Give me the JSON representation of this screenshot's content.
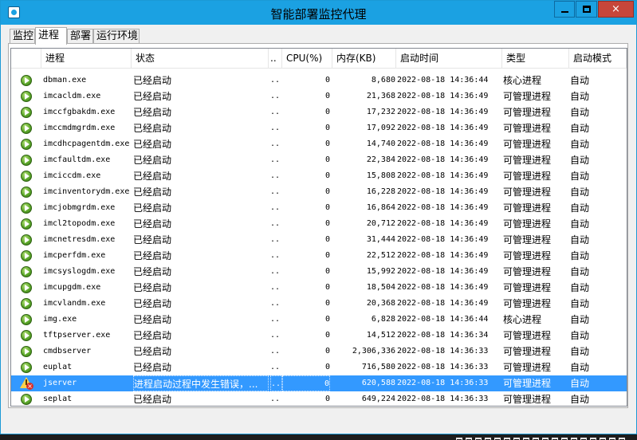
{
  "window": {
    "title": "智能部署监控代理",
    "min_label": "",
    "max_label": "",
    "close_label": "×"
  },
  "tabs": [
    {
      "label": "监控"
    },
    {
      "label": "进程"
    },
    {
      "label": "部署"
    },
    {
      "label": "运行环境"
    }
  ],
  "columns": {
    "process": "进程",
    "status": "状态",
    "more": "..",
    "cpu": "CPU(%)",
    "mem": "内存(KB)",
    "start_time": "启动时间",
    "type": "类型",
    "start_mode": "启动模式"
  },
  "rows": [
    {
      "icon": "ok",
      "name": "dbman.exe",
      "status": "已经启动",
      "more": "..",
      "cpu": "0",
      "mem": "8,680",
      "time": "2022-08-18 14:36:44",
      "type": "核心进程",
      "mode": "自动"
    },
    {
      "icon": "ok",
      "name": "imcacldm.exe",
      "status": "已经启动",
      "more": "..",
      "cpu": "0",
      "mem": "21,368",
      "time": "2022-08-18 14:36:49",
      "type": "可管理进程",
      "mode": "自动"
    },
    {
      "icon": "ok",
      "name": "imccfgbakdm.exe",
      "status": "已经启动",
      "more": "..",
      "cpu": "0",
      "mem": "17,232",
      "time": "2022-08-18 14:36:49",
      "type": "可管理进程",
      "mode": "自动"
    },
    {
      "icon": "ok",
      "name": "imccmdmgrdm.exe",
      "status": "已经启动",
      "more": "..",
      "cpu": "0",
      "mem": "17,092",
      "time": "2022-08-18 14:36:49",
      "type": "可管理进程",
      "mode": "自动"
    },
    {
      "icon": "ok",
      "name": "imcdhcpagentdm.exe",
      "status": "已经启动",
      "more": "..",
      "cpu": "0",
      "mem": "14,740",
      "time": "2022-08-18 14:36:49",
      "type": "可管理进程",
      "mode": "自动"
    },
    {
      "icon": "ok",
      "name": "imcfaultdm.exe",
      "status": "已经启动",
      "more": "..",
      "cpu": "0",
      "mem": "22,384",
      "time": "2022-08-18 14:36:49",
      "type": "可管理进程",
      "mode": "自动"
    },
    {
      "icon": "ok",
      "name": "imciccdm.exe",
      "status": "已经启动",
      "more": "..",
      "cpu": "0",
      "mem": "15,808",
      "time": "2022-08-18 14:36:49",
      "type": "可管理进程",
      "mode": "自动"
    },
    {
      "icon": "ok",
      "name": "imcinventorydm.exe",
      "status": "已经启动",
      "more": "..",
      "cpu": "0",
      "mem": "16,228",
      "time": "2022-08-18 14:36:49",
      "type": "可管理进程",
      "mode": "自动"
    },
    {
      "icon": "ok",
      "name": "imcjobmgrdm.exe",
      "status": "已经启动",
      "more": "..",
      "cpu": "0",
      "mem": "16,864",
      "time": "2022-08-18 14:36:49",
      "type": "可管理进程",
      "mode": "自动"
    },
    {
      "icon": "ok",
      "name": "imcl2topodm.exe",
      "status": "已经启动",
      "more": "..",
      "cpu": "0",
      "mem": "20,712",
      "time": "2022-08-18 14:36:49",
      "type": "可管理进程",
      "mode": "自动"
    },
    {
      "icon": "ok",
      "name": "imcnetresdm.exe",
      "status": "已经启动",
      "more": "..",
      "cpu": "0",
      "mem": "31,444",
      "time": "2022-08-18 14:36:49",
      "type": "可管理进程",
      "mode": "自动"
    },
    {
      "icon": "ok",
      "name": "imcperfdm.exe",
      "status": "已经启动",
      "more": "..",
      "cpu": "0",
      "mem": "22,512",
      "time": "2022-08-18 14:36:49",
      "type": "可管理进程",
      "mode": "自动"
    },
    {
      "icon": "ok",
      "name": "imcsyslogdm.exe",
      "status": "已经启动",
      "more": "..",
      "cpu": "0",
      "mem": "15,992",
      "time": "2022-08-18 14:36:49",
      "type": "可管理进程",
      "mode": "自动"
    },
    {
      "icon": "ok",
      "name": "imcupgdm.exe",
      "status": "已经启动",
      "more": "..",
      "cpu": "0",
      "mem": "18,504",
      "time": "2022-08-18 14:36:49",
      "type": "可管理进程",
      "mode": "自动"
    },
    {
      "icon": "ok",
      "name": "imcvlandm.exe",
      "status": "已经启动",
      "more": "..",
      "cpu": "0",
      "mem": "20,368",
      "time": "2022-08-18 14:36:49",
      "type": "可管理进程",
      "mode": "自动"
    },
    {
      "icon": "ok",
      "name": "img.exe",
      "status": "已经启动",
      "more": "..",
      "cpu": "0",
      "mem": "6,828",
      "time": "2022-08-18 14:36:44",
      "type": "核心进程",
      "mode": "自动"
    },
    {
      "icon": "ok",
      "name": "tftpserver.exe",
      "status": "已经启动",
      "more": "..",
      "cpu": "0",
      "mem": "14,512",
      "time": "2022-08-18 14:36:34",
      "type": "可管理进程",
      "mode": "自动"
    },
    {
      "icon": "ok",
      "name": "cmdbserver",
      "status": "已经启动",
      "more": "..",
      "cpu": "0",
      "mem": "2,306,336",
      "time": "2022-08-18 14:36:33",
      "type": "可管理进程",
      "mode": "自动"
    },
    {
      "icon": "ok",
      "name": "euplat",
      "status": "已经启动",
      "more": "..",
      "cpu": "0",
      "mem": "716,580",
      "time": "2022-08-18 14:36:33",
      "type": "可管理进程",
      "mode": "自动"
    },
    {
      "icon": "error",
      "name": "jserver",
      "status": "进程启动过程中发生错误，...",
      "more": "..",
      "cpu": "0",
      "mem": "620,588",
      "time": "2022-08-18 14:36:33",
      "type": "可管理进程",
      "mode": "自动",
      "selected": true
    },
    {
      "icon": "ok",
      "name": "seplat",
      "status": "已经启动",
      "more": "..",
      "cpu": "0",
      "mem": "649,224",
      "time": "2022-08-18 14:36:33",
      "type": "可管理进程",
      "mode": "自动"
    }
  ]
}
